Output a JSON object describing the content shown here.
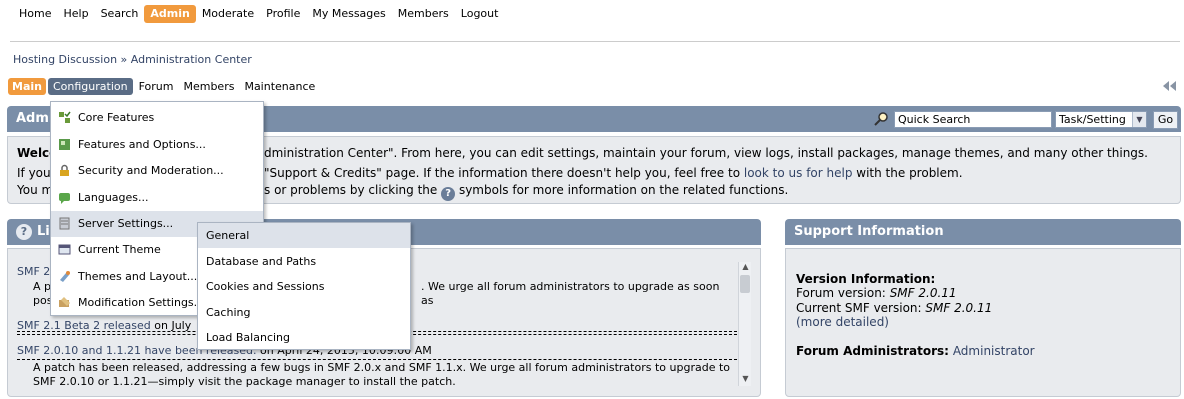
{
  "top_menu": [
    "Home",
    "Help",
    "Search",
    "Admin",
    "Moderate",
    "Profile",
    "My Messages",
    "Members",
    "Logout"
  ],
  "top_menu_active": "Admin",
  "breadcrumb": "Hosting Discussion » Administration Center",
  "admin_tabs": [
    "Main",
    "Configuration",
    "Forum",
    "Members",
    "Maintenance"
  ],
  "title_bar": {
    "title": "Admin",
    "quick_search_value": "Quick Search",
    "select_value": "Task/Setting",
    "go_label": "Go"
  },
  "welcome": {
    "line1_bold": "Welco",
    "line1": "dministration Center\". From here, you can edit settings, maintain your forum, view logs, install packages, manage themes, and many other things.",
    "line2_start": "If you",
    "line2": "\"Support & Credits\" page. If the information there doesn't help you, feel free to",
    "line2_link": "look to us for help",
    "line2_end": "with the problem.",
    "line3_start": "You m",
    "line3": "s or problems by clicking the",
    "line3_end": "symbols for more information on the related functions."
  },
  "live_news": {
    "title": "Liv",
    "items": [
      {
        "title": "SMF 2",
        "date": "",
        "body_a": "A pa",
        "body_b": ". We urge all forum administrators to upgrade as soon as",
        "body_c": "pos"
      },
      {
        "title": "SMF 2.1 Beta 2 released",
        "date": "on July"
      },
      {
        "title": "SMF 2.0.10 and 1.1.21 have been released.",
        "date": "on April 24, 2015, 10:09:00 AM",
        "body": "A patch has been released, addressing a few bugs in SMF 2.0.x and SMF 1.1.x. We urge all forum administrators to upgrade to SMF 2.0.10 or 1.1.21—simply visit the package manager to install the patch."
      }
    ]
  },
  "support": {
    "title": "Support Information",
    "version_heading": "Version Information:",
    "forum_version_label": "Forum version:",
    "forum_version": "SMF 2.0.11",
    "current_version_label": "Current SMF version:",
    "current_version": "SMF 2.0.11",
    "more_detailed": "(more detailed)",
    "admins_label": "Forum Administrators:",
    "admins": "Administrator"
  },
  "config_menu": [
    {
      "label": "Core Features",
      "icon": "core-features-icon"
    },
    {
      "label": "Features and Options...",
      "icon": "features-options-icon"
    },
    {
      "label": "Security and Moderation...",
      "icon": "security-lock-icon"
    },
    {
      "label": "Languages...",
      "icon": "languages-icon"
    },
    {
      "label": "Server Settings...",
      "icon": "server-settings-icon"
    },
    {
      "label": "Current Theme",
      "icon": "current-theme-icon"
    },
    {
      "label": "Themes and Layout...",
      "icon": "themes-layout-icon"
    },
    {
      "label": "Modification Settings...",
      "icon": "modification-settings-icon"
    }
  ],
  "server_submenu": [
    "General",
    "Database and Paths",
    "Cookies and Sessions",
    "Caching",
    "Load Balancing"
  ],
  "colors": {
    "accent": "#f19a3d",
    "titlebar": "#7a8ea8",
    "panel": "#e9ebee",
    "link": "#334466"
  }
}
